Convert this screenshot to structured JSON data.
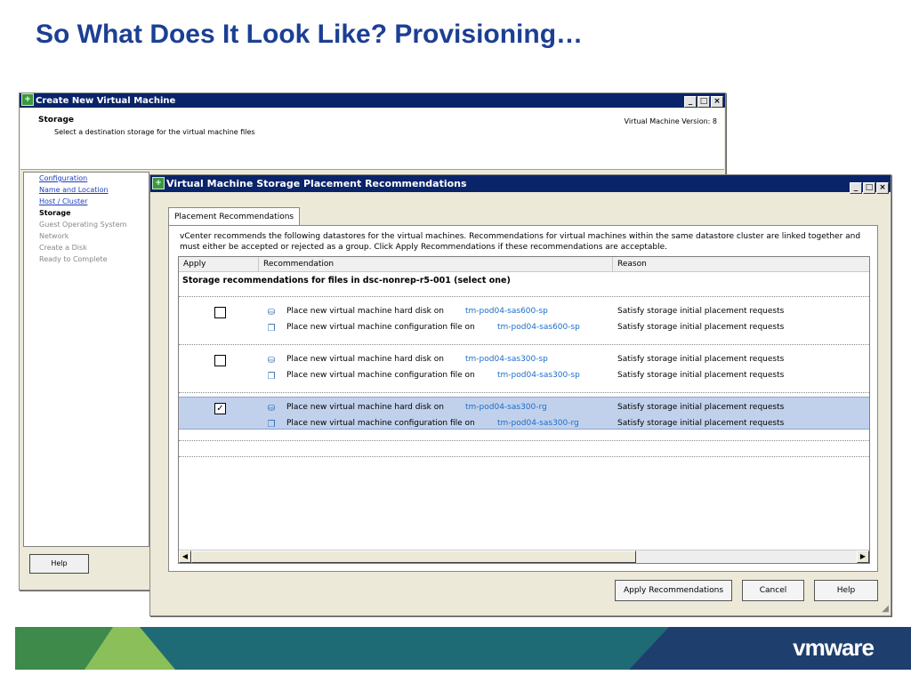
{
  "slide": {
    "title": "So What Does It Look Like? Provisioning…"
  },
  "back_window": {
    "title": "Create New Virtual Machine",
    "controls": [
      "_",
      "□",
      "×"
    ],
    "header_title": "Storage",
    "header_subtitle": "Select a destination storage for the virtual machine files",
    "version": "Virtual Machine Version: 8",
    "nav": [
      "Configuration",
      "Name and Location",
      "Host / Cluster",
      "Storage",
      "Guest Operating System",
      "Network",
      "Create a Disk",
      "Ready to Complete"
    ],
    "help": "Help"
  },
  "front_window": {
    "title": "Virtual Machine Storage Placement Recommendations",
    "controls": [
      "_",
      "□",
      "×"
    ],
    "tab": "Placement Recommendations",
    "description": "vCenter recommends the following datastores for the virtual machines. Recommendations for virtual machines within the same datastore cluster are linked together and must either be accepted or rejected as a group. Click Apply Recommendations if these recommendations are acceptable.",
    "columns": [
      "Apply",
      "Recommendation",
      "Reason"
    ],
    "group_header": "Storage recommendations for files in dsc-nonrep-r5-001 (select one)",
    "groups": [
      {
        "checked": false,
        "rows": [
          {
            "text": "Place new virtual machine hard disk on",
            "target": "tm-pod04-sas600-sp",
            "reason": "Satisfy storage initial placement requests"
          },
          {
            "text": "Place new virtual machine configuration file on",
            "target": "tm-pod04-sas600-sp",
            "reason": "Satisfy storage initial placement requests"
          }
        ]
      },
      {
        "checked": false,
        "rows": [
          {
            "text": "Place new virtual machine hard disk on",
            "target": "tm-pod04-sas300-sp",
            "reason": "Satisfy storage initial placement requests"
          },
          {
            "text": "Place new virtual machine configuration file on",
            "target": "tm-pod04-sas300-sp",
            "reason": "Satisfy storage initial placement requests"
          }
        ]
      },
      {
        "checked": true,
        "rows": [
          {
            "text": "Place new virtual machine hard disk on",
            "target": "tm-pod04-sas300-rg",
            "reason": "Satisfy storage initial placement requests"
          },
          {
            "text": "Place new virtual machine configuration file on",
            "target": "tm-pod04-sas300-rg",
            "reason": "Satisfy storage initial placement requests"
          }
        ]
      }
    ],
    "check_mark": "✓",
    "buttons": {
      "apply": "Apply Recommendations",
      "cancel": "Cancel",
      "help": "Help"
    }
  },
  "footer": {
    "logo": "vmware"
  },
  "colors": {
    "title": "#1c3f94",
    "titlebar": "#0a246a",
    "selection": "#c1d1ec",
    "link": "#1c6ec8",
    "footer_teal": "#1f6b75",
    "footer_green": "#3d8a4a",
    "footer_navy": "#1e3f6e"
  }
}
